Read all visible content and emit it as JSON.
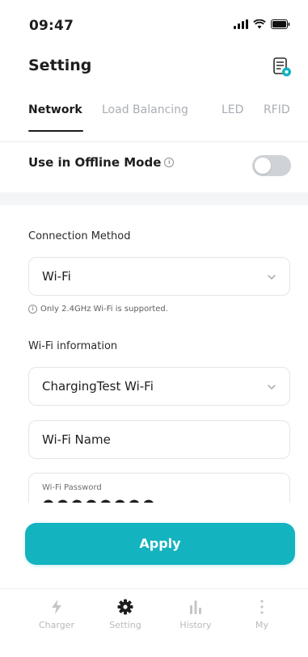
{
  "status_bar": {
    "time": "09:47"
  },
  "header": {
    "title": "Setting",
    "icon": "document-settings-icon",
    "icon_color": "#14b3c0"
  },
  "tabs": [
    {
      "label": "Network",
      "active": true
    },
    {
      "label": "Load Balancing",
      "active": false
    },
    {
      "label": "LED",
      "active": false
    },
    {
      "label": "RFID",
      "active": false
    }
  ],
  "offline": {
    "label": "Use in Offline Mode",
    "enabled": false
  },
  "connection": {
    "label": "Connection Method",
    "value": "Wi-Fi",
    "note": "Only 2.4GHz Wi-Fi is supported."
  },
  "wifi": {
    "label": "Wi-Fi information",
    "network_value": "ChargingTest Wi-Fi",
    "name_placeholder": "Wi-Fi Name",
    "password_label": "Wi-Fi Password",
    "password_mask": "●●●●●●●●"
  },
  "apply_label": "Apply",
  "accent_color": "#14b3c0",
  "bottom_nav": [
    {
      "label": "Charger",
      "icon": "lightning-icon",
      "active": false
    },
    {
      "label": "Setting",
      "icon": "gear-icon",
      "active": true
    },
    {
      "label": "History",
      "icon": "bar-chart-icon",
      "active": false
    },
    {
      "label": "My",
      "icon": "more-vertical-icon",
      "active": false
    }
  ]
}
